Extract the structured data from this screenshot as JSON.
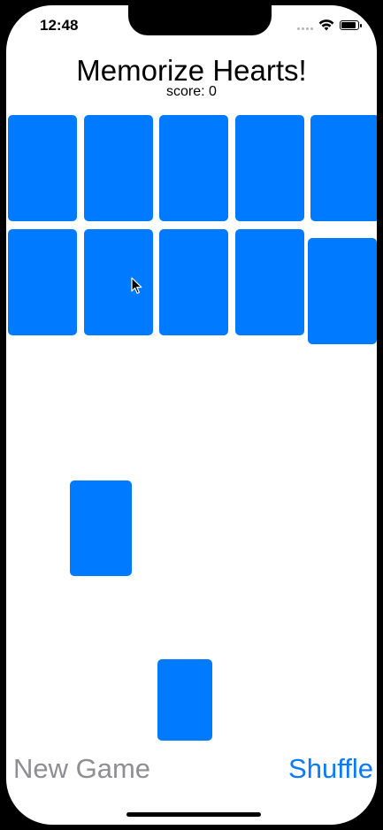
{
  "status_bar": {
    "time": "12:48"
  },
  "header": {
    "title": "Memorize Hearts!",
    "score": "score: 0"
  },
  "colors": {
    "card_back": "#007aff",
    "disabled_button": "#8e8e93",
    "accent": "#0a7aff"
  },
  "toolbar": {
    "new_game_label": "New Game",
    "shuffle_label": "Shuffle"
  }
}
